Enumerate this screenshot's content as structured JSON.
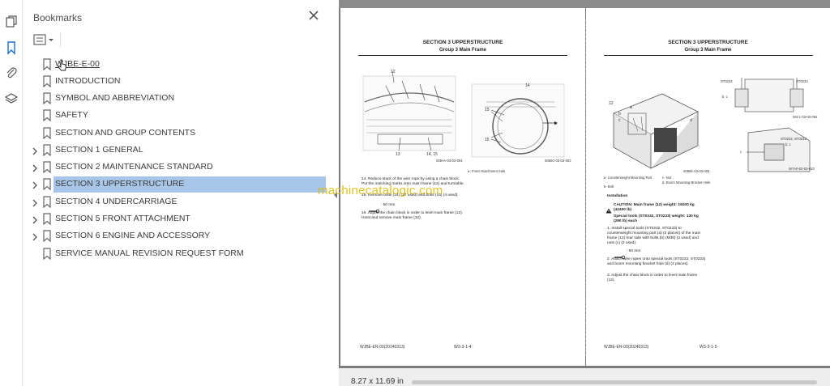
{
  "sidebar_rail": {
    "icons": [
      "pages-icon",
      "bookmarks-icon",
      "attachments-icon",
      "layers-icon"
    ]
  },
  "bookmarks_panel": {
    "title": "Bookmarks",
    "items": [
      {
        "label": "WJBE-E-00",
        "expandable": false
      },
      {
        "label": "INTRODUCTION",
        "expandable": false
      },
      {
        "label": "SYMBOL AND ABBREVIATION",
        "expandable": false
      },
      {
        "label": "SAFETY",
        "expandable": false
      },
      {
        "label": "SECTION AND GROUP CONTENTS",
        "expandable": false
      },
      {
        "label": "SECTION 1 GENERAL",
        "expandable": true
      },
      {
        "label": "SECTION 2 MAINTENANCE STANDARD",
        "expandable": true
      },
      {
        "label": "SECTION 3 UPPERSTRUCTURE",
        "expandable": true,
        "selected": true
      },
      {
        "label": "SECTION 4 UNDERCARRIAGE",
        "expandable": true
      },
      {
        "label": "SECTION 5 FRONT ATTACHMENT",
        "expandable": true
      },
      {
        "label": "SECTION 6 ENGINE AND ACCESSORY",
        "expandable": true
      },
      {
        "label": "SERVICE MANUAL REVISION REQUEST FORM",
        "expandable": false
      }
    ]
  },
  "watermark": "machinecatalogic.com",
  "left_page": {
    "section_title": "SECTION 3 UPPERSTRUCTURE",
    "group_title": "Group 3 Main Frame",
    "fig1_callouts": [
      "12",
      "13",
      "14, 15"
    ],
    "fig1_code": "W3HA-03-03-004",
    "fig2_callouts": [
      "14",
      "15",
      "15",
      "a"
    ],
    "fig2_code": "W3BC-03-03-002",
    "fig2_caption": "a-     Front Attachment Side",
    "steps": [
      "14.  Reduce slack of the wire rope by using a chain block. Put the matching marks onto main frame (12) and turntable.",
      "15.  Remove bolts (14) (37 used) and bolts (15) (4 used).",
      ": 50 mm",
      "16.  Adjust the chain block in order to level main frame (12). Hoist and remove main frame (12)."
    ],
    "footer_left": "WJBE-EN-00(20240313)",
    "footer_right": "W3-3-1-4"
  },
  "right_page": {
    "section_title": "SECTION 3 UPPERSTRUCTURE",
    "group_title": "Group 3 Main Frame",
    "fig1_callouts": [
      "12",
      "a",
      "b",
      "c",
      "d"
    ],
    "fig1_code": "W3BE-03-03-003",
    "fig2_labels": [
      "ST0232",
      "ST0233",
      "b, c"
    ],
    "fig2_code": "W3-1-03-03-002",
    "fig3_labels": [
      "ST0232, ST0233",
      "b, c",
      "c"
    ],
    "fig3_code": "W7A0-03-03-010",
    "legend": [
      "a-   Counterweight Mounting Part",
      "c-   Nut",
      "b-   Bolt",
      "d-   Boom Mounting Bracket Hole"
    ],
    "installation_heading": "Installation",
    "caution": "CAUTION:  Main frame (12) weight: 19200 kg (42400 lb)",
    "special_tools": "Special tools (ST0232, ST0233) weight: 130 kg (290 lb) each",
    "steps": [
      "1.  Install special tools (ST0232, ST0233) to counterweight mounting part (a) (2 places) of the main frame (12) rear side with bolts (b) (M36) (2 used) and nuts (c) (2 used).",
      ": 60 mm",
      "2.  Attach wire ropes onto special tools (ST0232, ST0233) and boom mounting bracket hole (d) (2 places).",
      "3.  Adjust the chain block in order to level main frame (12)."
    ],
    "footer_left": "WJBE-EN-00(20240313)",
    "footer_right": "W3-3-1-5"
  },
  "status": {
    "page_size": "8.27 x 11.69 in"
  },
  "colors": {
    "selection": "#a7c5e6",
    "doc_background": "#7b7b7b",
    "watermark": "#d9b800"
  }
}
